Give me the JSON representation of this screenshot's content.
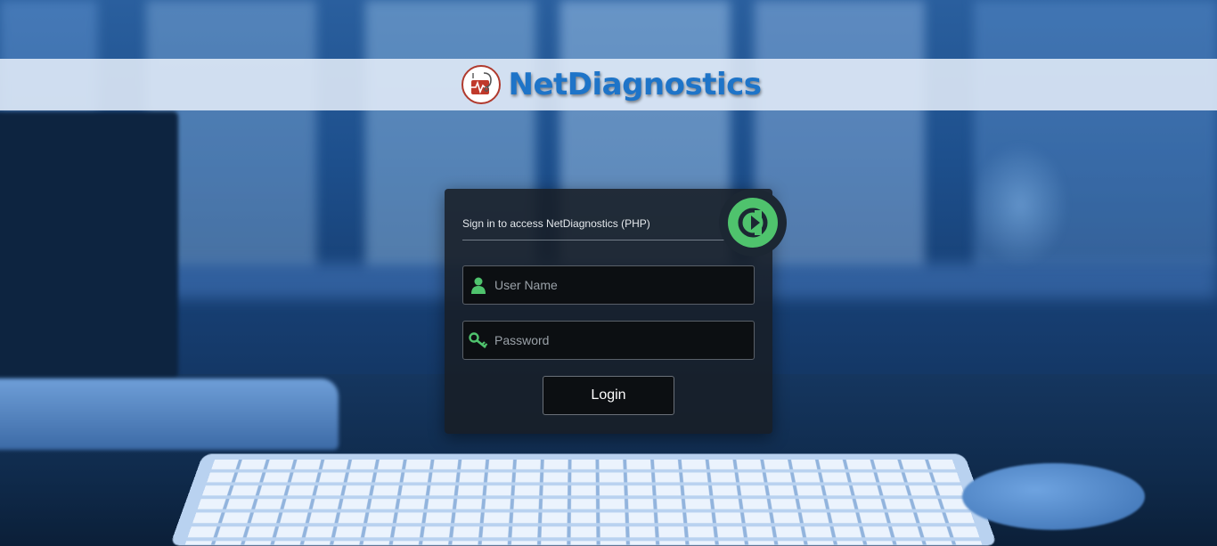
{
  "header": {
    "brand_name": "NetDiagnostics",
    "logo_icon": "stethoscope-heartbeat-logo"
  },
  "login": {
    "title": "Sign in to access NetDiagnostics (PHP)",
    "badge_icon": "login-arrow-icon",
    "username": {
      "placeholder": "User Name",
      "value": "",
      "icon": "user-icon"
    },
    "password": {
      "placeholder": "Password",
      "value": "",
      "icon": "key-icon"
    },
    "submit_label": "Login"
  },
  "colors": {
    "brand_blue": "#1e74c8",
    "accent_green": "#4fc36d",
    "logo_red": "#b03a2e",
    "card_bg": "#181e26"
  }
}
